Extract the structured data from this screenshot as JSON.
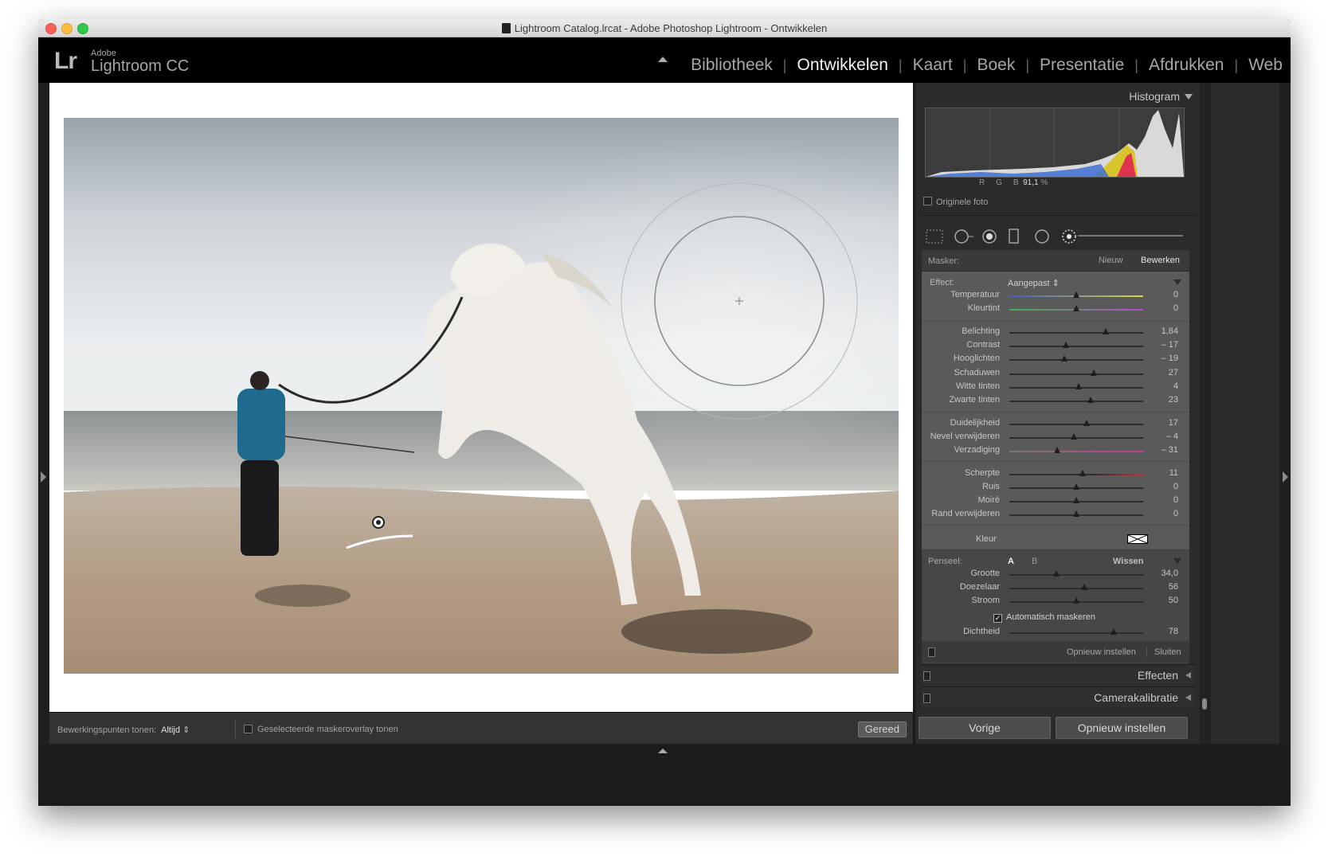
{
  "window": {
    "title": "Lightroom Catalog.lrcat - Adobe Photoshop Lightroom - Ontwikkelen"
  },
  "brand": {
    "mark": "Lr",
    "adobe": "Adobe",
    "product": "Lightroom CC"
  },
  "modules": [
    {
      "label": "Bibliotheek",
      "active": false
    },
    {
      "label": "Ontwikkelen",
      "active": true
    },
    {
      "label": "Kaart",
      "active": false
    },
    {
      "label": "Boek",
      "active": false
    },
    {
      "label": "Presentatie",
      "active": false
    },
    {
      "label": "Afdrukken",
      "active": false
    },
    {
      "label": "Web",
      "active": false
    }
  ],
  "toolbar": {
    "show_pins_label": "Bewerkingspunten tonen:",
    "show_pins_value": "Altijd",
    "overlay_label": "Geselecteerde maskeroverlay tonen",
    "done_label": "Gereed"
  },
  "histogram": {
    "title": "Histogram",
    "r_label": "R",
    "g_label": "G",
    "b_label": "B",
    "b_value": "91,1",
    "pct": "%",
    "original_photo": "Originele foto"
  },
  "mask": {
    "label": "Masker:",
    "new": "Nieuw",
    "edit": "Bewerken"
  },
  "effect": {
    "label": "Effect:",
    "preset": "Aangepast",
    "sliders": [
      {
        "label": "Temperatuur",
        "value": "0",
        "pos": 0.5
      },
      {
        "label": "Kleurtint",
        "value": "0",
        "pos": 0.5
      },
      {
        "label": "Belichting",
        "value": "1,84",
        "pos": 0.72
      },
      {
        "label": "Contrast",
        "value": "– 17",
        "pos": 0.42
      },
      {
        "label": "Hooglichten",
        "value": "– 19",
        "pos": 0.41
      },
      {
        "label": "Schaduwen",
        "value": "27",
        "pos": 0.63
      },
      {
        "label": "Witte tinten",
        "value": "4",
        "pos": 0.52
      },
      {
        "label": "Zwarte tinten",
        "value": "23",
        "pos": 0.61
      },
      {
        "label": "Duidelijkheid",
        "value": "17",
        "pos": 0.58
      },
      {
        "label": "Nevel verwijderen",
        "value": "– 4",
        "pos": 0.48
      },
      {
        "label": "Verzadiging",
        "value": "– 31",
        "pos": 0.36
      },
      {
        "label": "Scherpte",
        "value": "11",
        "pos": 0.55
      },
      {
        "label": "Ruis",
        "value": "0",
        "pos": 0.5
      },
      {
        "label": "Moiré",
        "value": "0",
        "pos": 0.5
      },
      {
        "label": "Rand verwijderen",
        "value": "0",
        "pos": 0.5
      }
    ],
    "color_label": "Kleur"
  },
  "brush": {
    "label": "Penseel:",
    "a": "A",
    "b": "B",
    "erase": "Wissen",
    "sliders": [
      {
        "label": "Grootte",
        "value": "34,0",
        "pos": 0.35
      },
      {
        "label": "Doezelaar",
        "value": "56",
        "pos": 0.56
      },
      {
        "label": "Stroom",
        "value": "50",
        "pos": 0.5
      }
    ],
    "auto_mask": "Automatisch maskeren",
    "density": {
      "label": "Dichtheid",
      "value": "78",
      "pos": 0.78
    }
  },
  "panel_footer": {
    "reset": "Opnieuw instellen",
    "close": "Sluiten"
  },
  "sections": {
    "effects": "Effecten",
    "calibration": "Camerakalibratie"
  },
  "buttons": {
    "previous": "Vorige",
    "reset": "Opnieuw instellen"
  }
}
